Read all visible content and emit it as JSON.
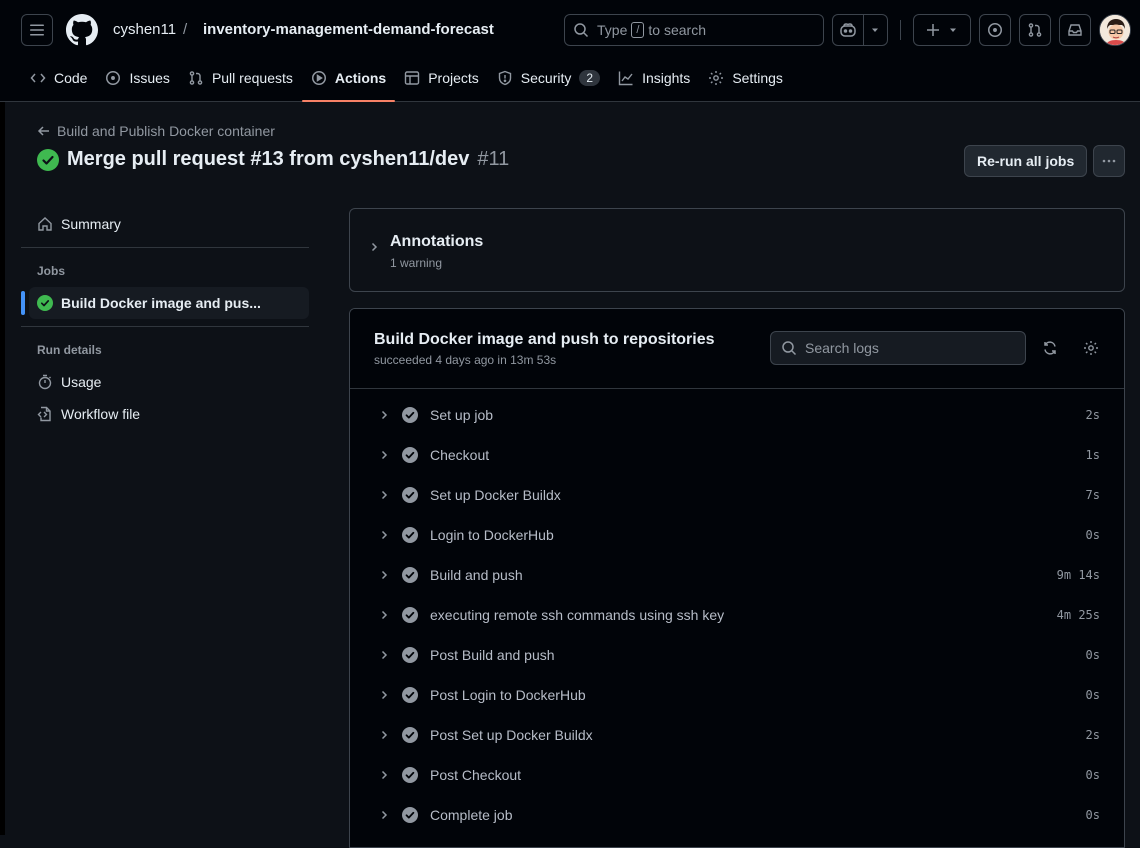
{
  "header": {
    "owner": "cyshen11",
    "separator": "/",
    "repo": "inventory-management-demand-forecast",
    "search_prefix": "Type",
    "search_key": "/",
    "search_suffix": "to search"
  },
  "tabs": [
    {
      "label": "Code",
      "icon": "code-icon"
    },
    {
      "label": "Issues",
      "icon": "issue-icon"
    },
    {
      "label": "Pull requests",
      "icon": "pull-request-icon"
    },
    {
      "label": "Actions",
      "icon": "play-icon",
      "selected": true
    },
    {
      "label": "Projects",
      "icon": "table-icon"
    },
    {
      "label": "Security",
      "icon": "shield-icon",
      "count": "2"
    },
    {
      "label": "Insights",
      "icon": "graph-icon"
    },
    {
      "label": "Settings",
      "icon": "gear-icon"
    }
  ],
  "run": {
    "workflow_name": "Build and Publish Docker container",
    "title": "Merge pull request #13 from cyshen11/dev",
    "number": "#11",
    "rerun_label": "Re-run all jobs"
  },
  "sidebar": {
    "summary": "Summary",
    "jobs_heading": "Jobs",
    "job_label": "Build Docker image and pus...",
    "run_details_heading": "Run details",
    "usage": "Usage",
    "workflow_file": "Workflow file"
  },
  "annotations": {
    "title": "Annotations",
    "subtitle": "1 warning"
  },
  "job": {
    "title": "Build Docker image and push to repositories",
    "subtitle": "succeeded 4 days ago in 13m 53s",
    "search_placeholder": "Search logs",
    "steps": [
      {
        "name": "Set up job",
        "duration": "2s"
      },
      {
        "name": "Checkout",
        "duration": "1s"
      },
      {
        "name": "Set up Docker Buildx",
        "duration": "7s"
      },
      {
        "name": "Login to DockerHub",
        "duration": "0s"
      },
      {
        "name": "Build and push",
        "duration": "9m 14s"
      },
      {
        "name": "executing remote ssh commands using ssh key",
        "duration": "4m 25s"
      },
      {
        "name": "Post Build and push",
        "duration": "0s"
      },
      {
        "name": "Post Login to DockerHub",
        "duration": "0s"
      },
      {
        "name": "Post Set up Docker Buildx",
        "duration": "2s"
      },
      {
        "name": "Post Checkout",
        "duration": "0s"
      },
      {
        "name": "Complete job",
        "duration": "0s"
      }
    ]
  },
  "colors": {
    "success": "#3fb950",
    "step_check": "#9198a1",
    "accent_underline": "#f78166",
    "active_marker": "#4493f8"
  }
}
